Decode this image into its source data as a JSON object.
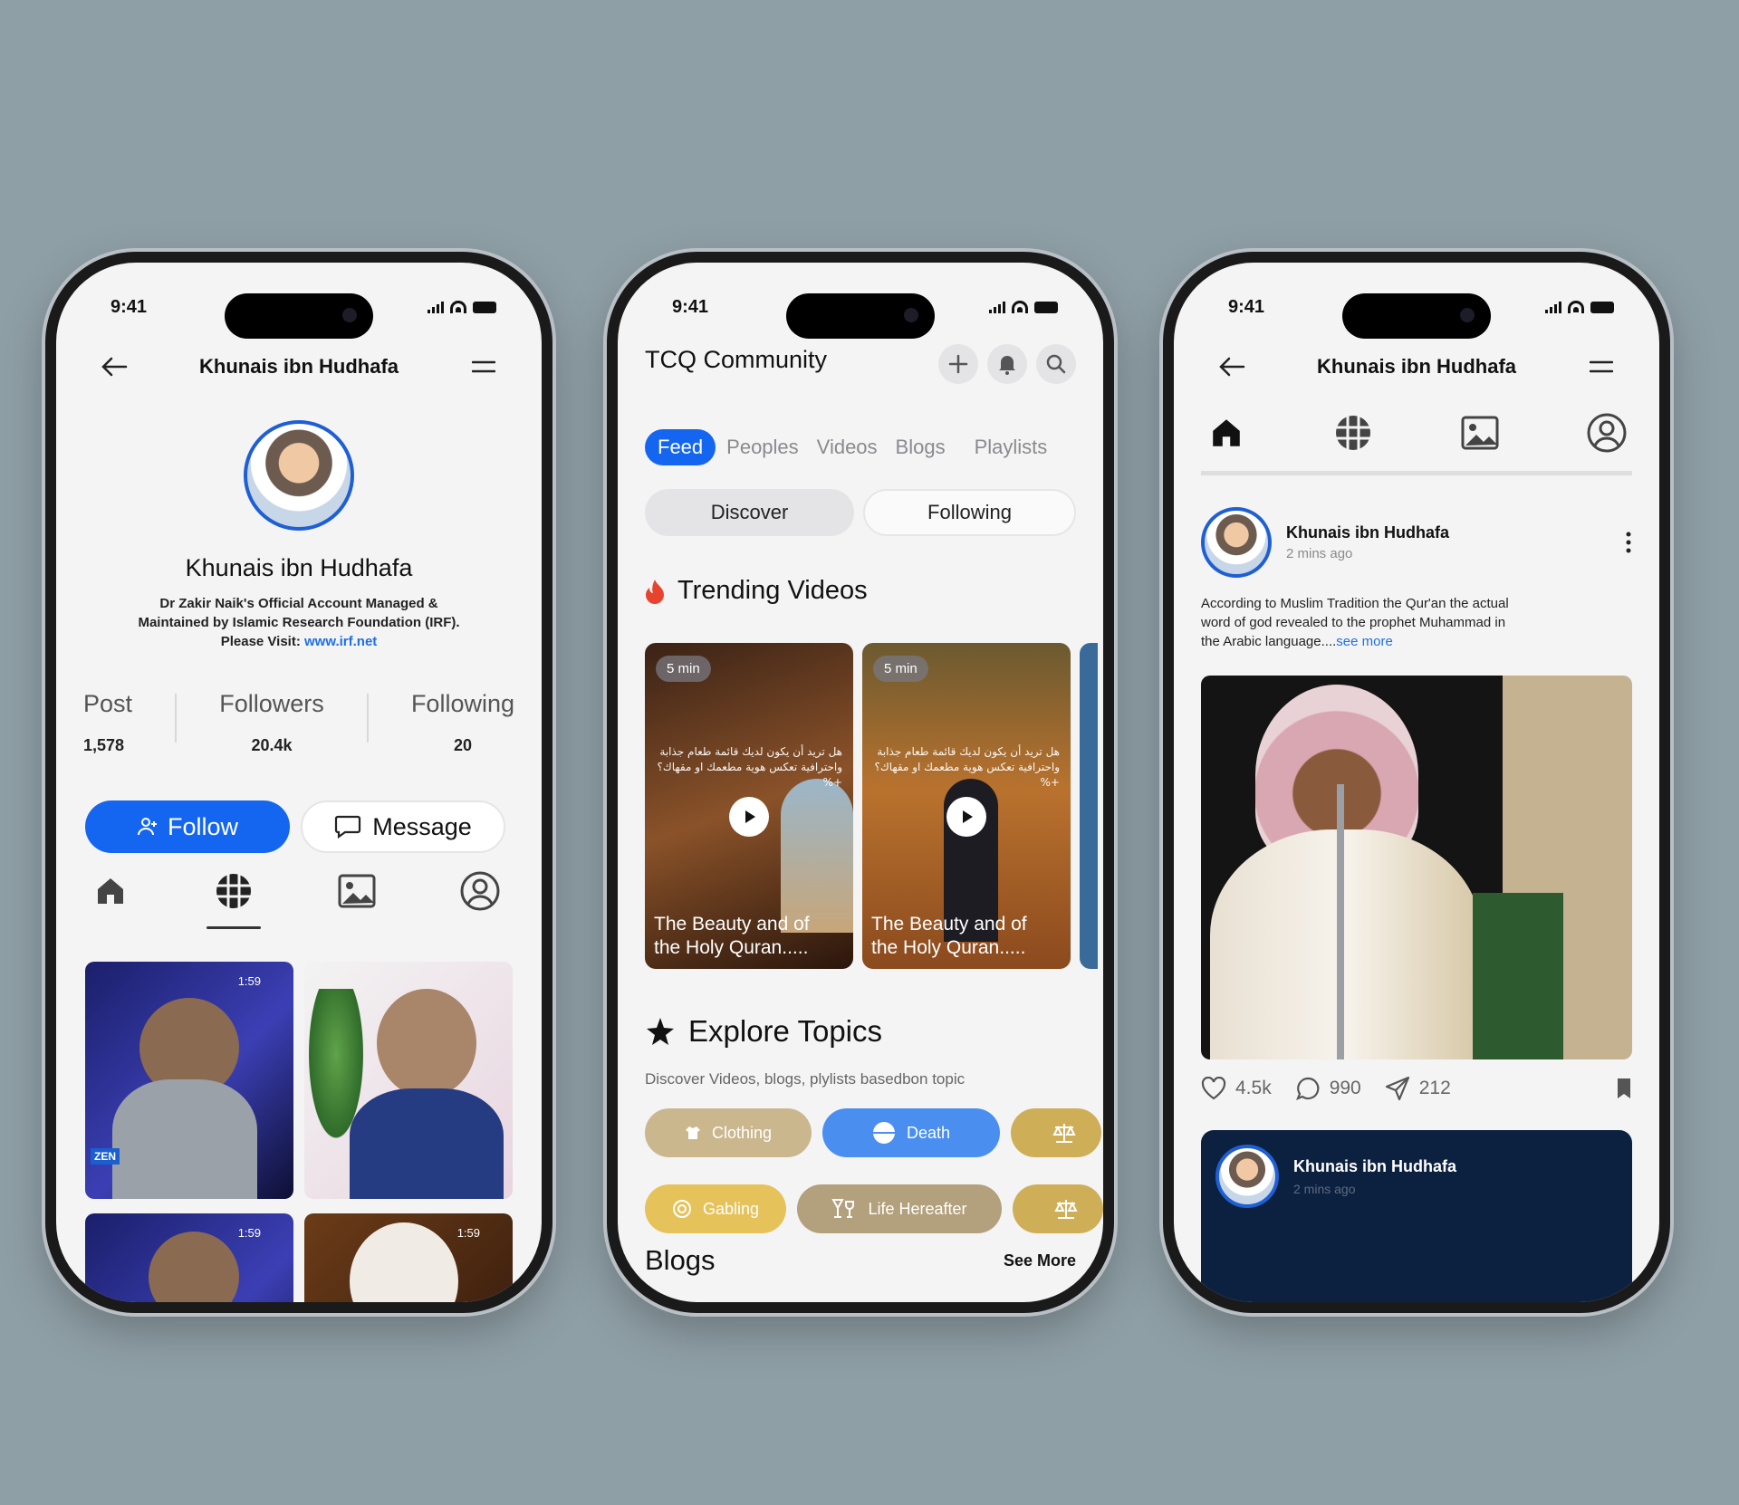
{
  "status": {
    "time": "9:41"
  },
  "profile": {
    "name": "Khunais ibn Hudhafa",
    "bio_line1": "Dr Zakir Naik's Official Account Managed &",
    "bio_line2": "Maintained by Islamic Research Foundation (IRF).",
    "bio_visit": "Please Visit: ",
    "bio_link": "www.irf.net",
    "stats": [
      {
        "label": "Post",
        "value": "1,578"
      },
      {
        "label": "Followers",
        "value": "20.4k"
      },
      {
        "label": "Following",
        "value": "20"
      }
    ],
    "follow_label": "Follow",
    "message_label": "Message",
    "thumb_durations": [
      "1:59",
      "1:59",
      "1:59"
    ],
    "thumb_badge": "ZEN"
  },
  "community": {
    "title": "TCQ Community",
    "tabs": [
      "Feed",
      "Peoples",
      "Videos",
      "Blogs",
      "Playlists"
    ],
    "segments": [
      "Discover",
      "Following"
    ],
    "trending_title": "Trending Videos",
    "videos": [
      {
        "duration": "5 min",
        "caption_1": "The Beauty and of",
        "caption_2": "the Holy Quran.....",
        "arabic": "هل تريد أن يكون لديك قائمة طعام جذابة واحترافية تعكس هوية مطعمك او مقهاك؟ %+"
      },
      {
        "duration": "5 min",
        "caption_1": "The Beauty and of",
        "caption_2": "the Holy Quran.....",
        "arabic": "هل تريد أن يكون لديك قائمة طعام جذابة واحترافية تعكس هوية مطعمك او مقهاك؟ %+"
      }
    ],
    "explore_title": "Explore Topics",
    "explore_sub": "Discover Videos, blogs, plylists basedbon topic",
    "chips_row1": [
      {
        "label": "Clothing",
        "color": "#cbb78e"
      },
      {
        "label": "Death",
        "color": "#4a8ff0"
      },
      {
        "label": "",
        "color": "#cfae58"
      }
    ],
    "chips_row2": [
      {
        "label": "Gabling",
        "color": "#e6c25a"
      },
      {
        "label": "Life Hereafter",
        "color": "#b3a07c"
      },
      {
        "label": "",
        "color": "#cfae58"
      }
    ],
    "blogs_title": "Blogs",
    "see_more": "See More"
  },
  "post": {
    "header_title": "Khunais ibn Hudhafa",
    "author": "Khunais ibn Hudhafa",
    "time": "2 mins ago",
    "text_1": "According to Muslim Tradition the Qur'an the actual",
    "text_2": "word of god revealed to the prophet Muhammad in",
    "text_3": "the Arabic language....",
    "see_more": "see more",
    "likes": "4.5k",
    "comments": "990",
    "shares": "212",
    "card_author": "Khunais ibn Hudhafa",
    "card_time": "2 mins ago"
  },
  "colors": {
    "accent": "#1466f0",
    "background": "#8f9fa6",
    "dark_card": "#0c2040"
  }
}
